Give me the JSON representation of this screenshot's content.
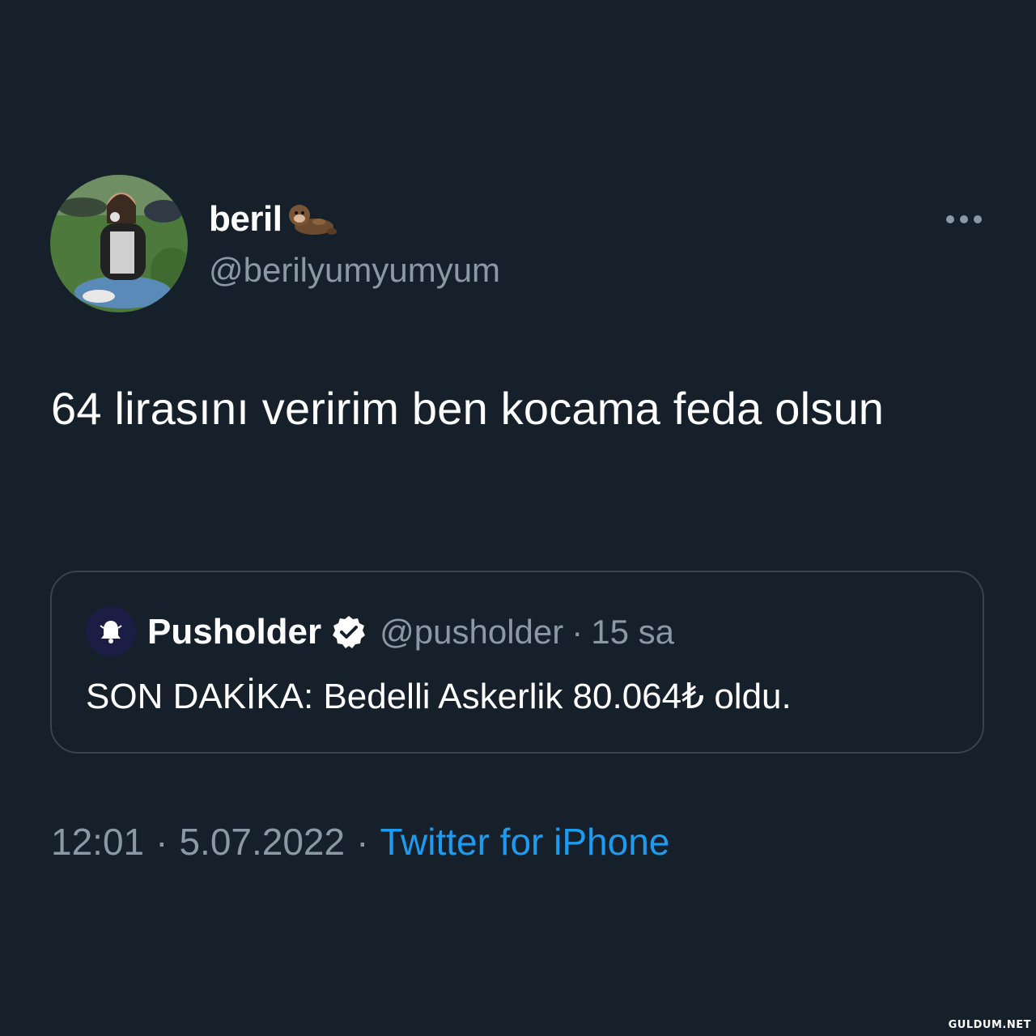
{
  "tweet": {
    "author": {
      "display_name": "beril",
      "handle": "@berilyumyumyum",
      "name_emoji": "otter-icon",
      "avatar": "profile-photo"
    },
    "text": "64 lirasını veririm ben kocama feda olsun",
    "more_icon": "more-horizontal-icon"
  },
  "quote": {
    "author": {
      "display_name": "Pusholder",
      "handle": "@pusholder",
      "verified": true,
      "avatar_icon": "bell-icon"
    },
    "separator": "·",
    "time": "15 sa",
    "text": "SON DAKİKA: Bedelli Askerlik 80.064₺ oldu."
  },
  "meta": {
    "time": "12:01",
    "date": "5.07.2022",
    "separator": "·",
    "source": "Twitter for iPhone"
  },
  "watermark": "GULDUM.NET",
  "colors": {
    "background": "#15202b",
    "text_primary": "#ffffff",
    "text_secondary": "#8b98a5",
    "accent": "#1d9bf0",
    "border": "#38444d"
  }
}
